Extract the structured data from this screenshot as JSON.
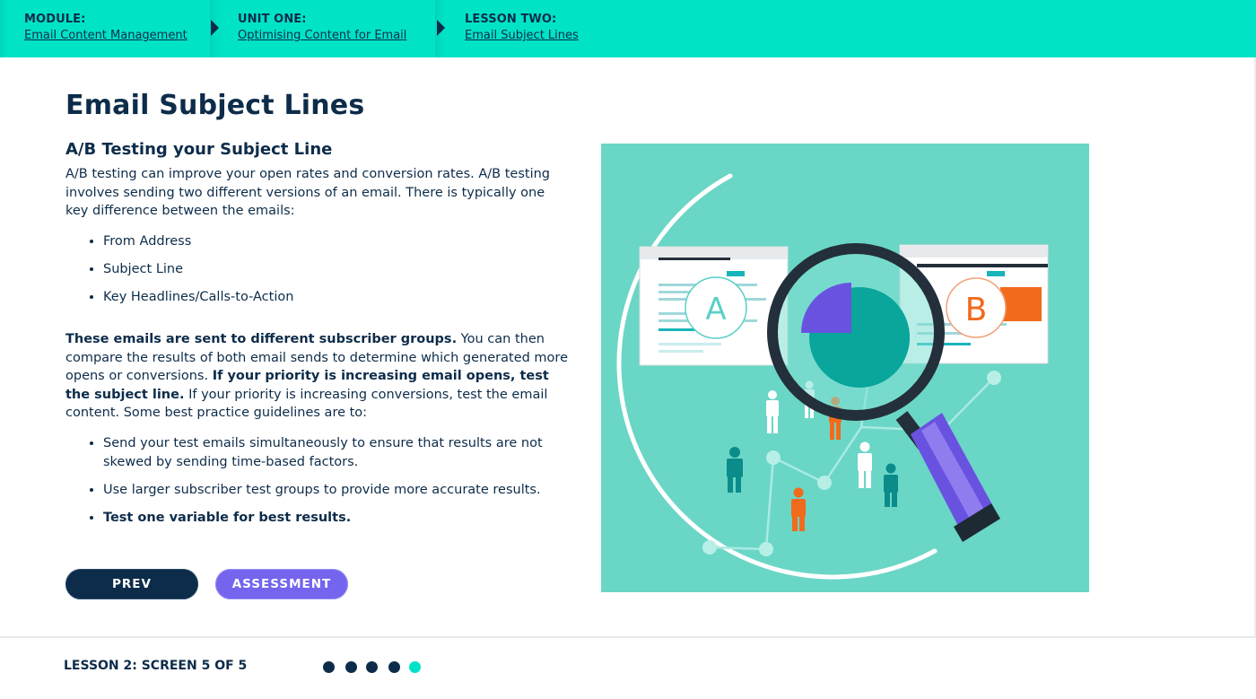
{
  "breadcrumb": {
    "module": {
      "caption": "MODULE:",
      "link": "Email Content Management"
    },
    "unit": {
      "caption": "UNIT ONE:",
      "link": "Optimising Content for Email"
    },
    "lesson": {
      "caption": "LESSON TWO:",
      "link": "Email Subject Lines"
    }
  },
  "main": {
    "page_title": "Email Subject Lines",
    "section_title": "A/B Testing your Subject Line",
    "intro": "A/B testing can improve your open rates and conversion rates. A/B testing involves sending two different versions of an email. There is typically one key difference between the emails:",
    "list1": [
      "From Address",
      "Subject Line",
      "Key Headlines/Calls-to-Action"
    ],
    "para2": {
      "bold1": "These emails are sent to different subscriber groups.",
      "text1": " You can then compare the results of both email sends to determine which generated more opens or conversions. ",
      "bold2": "If your priority is increasing email opens, test the subject line.",
      "text2": " If your priority is increasing conversions, test the email content. Some best practice guidelines are to:"
    },
    "list2": [
      "Send your test emails simultaneously to ensure that results are not skewed by sending time-based factors.",
      "Use larger subscriber test groups to provide more accurate results.",
      "Test one variable for best results."
    ],
    "illustration": {
      "letter_a": "A",
      "letter_b": "B",
      "colors": {
        "background": "#6ad6c6",
        "pie_primary": "#0aa59b",
        "pie_slice": "#6a52e0",
        "handle": "#6a52e0",
        "accent_orange": "#f26a1b",
        "person_teal": "#0b8c8a"
      }
    }
  },
  "buttons": {
    "prev": "PREV",
    "assessment": "ASSESSMENT"
  },
  "footer": {
    "progress_label": "LESSON 2: SCREEN 5 OF 5",
    "screens_total": 5,
    "current_screen": 5
  },
  "colors": {
    "accent": "#00e3c7",
    "navy": "#0d2c4a",
    "purple": "#7464ee"
  }
}
